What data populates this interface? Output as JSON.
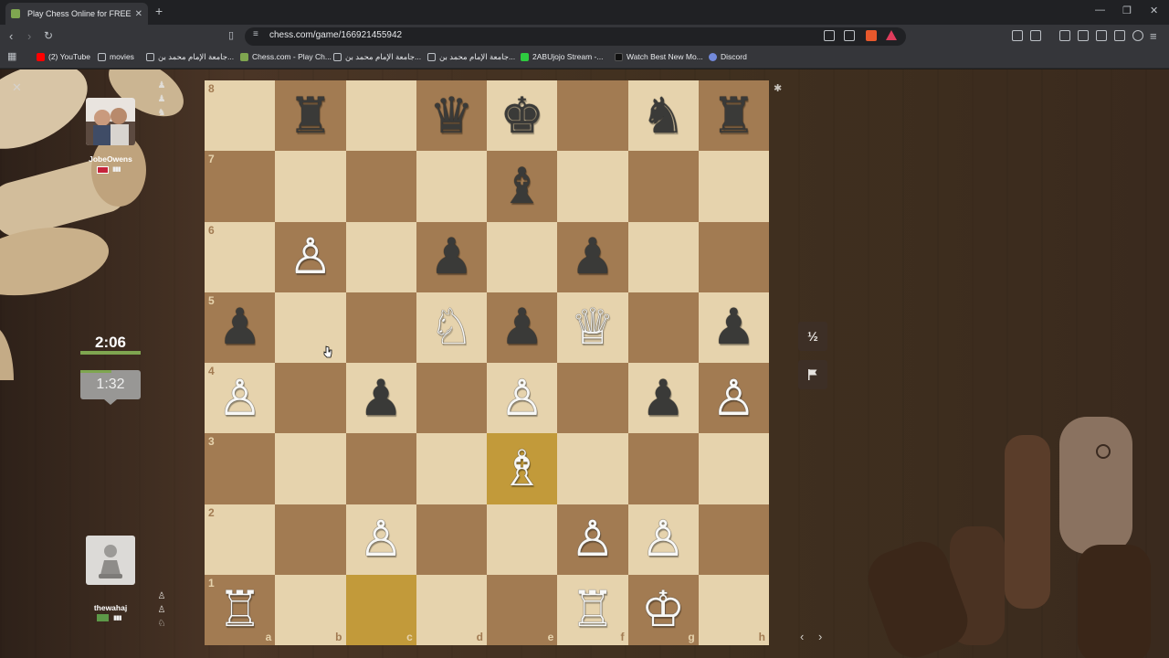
{
  "browser": {
    "tab_title": "Play Chess Online for FREE - ",
    "tab_close": "✕",
    "new_tab": "+",
    "url": "chess.com/game/166921455942",
    "window_controls": [
      "—",
      "❐",
      "✕"
    ],
    "bookmarks": [
      {
        "label": "(2) YouTube",
        "color": "#ff0000"
      },
      {
        "label": "movies",
        "color": "#bdc1c6"
      },
      {
        "label": "جامعة الإمام محمد بن...",
        "color": "#bdc1c6"
      },
      {
        "label": "Chess.com - Play Ch...",
        "color": "#7fa650"
      },
      {
        "label": "جامعة الإمام محمد بن...",
        "color": "#bdc1c6"
      },
      {
        "label": "جامعة الإمام محمد بن...",
        "color": "#bdc1c6"
      },
      {
        "label": "2ABUjojo Stream -...",
        "color": "#2ecc40"
      },
      {
        "label": "Watch Best New Mo...",
        "color": "#111111"
      },
      {
        "label": "Discord",
        "color": "#7289da"
      }
    ]
  },
  "game": {
    "opponent": {
      "name": "JobeOwens",
      "captured_icons": [
        "♟",
        "♟",
        "♞"
      ],
      "signal_icon": "signal-bars-icon",
      "flag_icon": "uk-flag-icon"
    },
    "player": {
      "name": "thewahaj",
      "captured_icons": [
        "♙",
        "♙",
        "♘"
      ],
      "signal_icon": "signal-bars-icon",
      "avatar_icon": "pawn-icon"
    },
    "clock_active": "2:06",
    "clock_idle": "1:32",
    "draw_label": "½",
    "resign_icon": "flag-icon",
    "nav_arrows": "‹ ›",
    "ranks": [
      "8",
      "7",
      "6",
      "5",
      "4",
      "3",
      "2",
      "1"
    ],
    "files": [
      "a",
      "b",
      "c",
      "d",
      "e",
      "f",
      "g",
      "h"
    ],
    "highlighted_squares": [
      "e3",
      "c1"
    ],
    "pieces": [
      {
        "square": "b8",
        "glyph": "♜",
        "color": "b",
        "name": "black-rook"
      },
      {
        "square": "d8",
        "glyph": "♛",
        "color": "b",
        "name": "black-queen"
      },
      {
        "square": "e8",
        "glyph": "♚",
        "color": "b",
        "name": "black-king"
      },
      {
        "square": "g8",
        "glyph": "♞",
        "color": "b",
        "name": "black-knight"
      },
      {
        "square": "h8",
        "glyph": "♜",
        "color": "b",
        "name": "black-rook"
      },
      {
        "square": "e7",
        "glyph": "♝",
        "color": "b",
        "name": "black-bishop"
      },
      {
        "square": "b6",
        "glyph": "♙",
        "color": "w",
        "name": "white-pawn"
      },
      {
        "square": "d6",
        "glyph": "♟",
        "color": "b",
        "name": "black-pawn"
      },
      {
        "square": "f6",
        "glyph": "♟",
        "color": "b",
        "name": "black-pawn"
      },
      {
        "square": "a5",
        "glyph": "♟",
        "color": "b",
        "name": "black-pawn"
      },
      {
        "square": "d5",
        "glyph": "♘",
        "color": "w",
        "name": "white-knight"
      },
      {
        "square": "e5",
        "glyph": "♟",
        "color": "b",
        "name": "black-pawn"
      },
      {
        "square": "f5",
        "glyph": "♕",
        "color": "w",
        "name": "white-queen"
      },
      {
        "square": "h5",
        "glyph": "♟",
        "color": "b",
        "name": "black-pawn"
      },
      {
        "square": "a4",
        "glyph": "♙",
        "color": "w",
        "name": "white-pawn"
      },
      {
        "square": "c4",
        "glyph": "♟",
        "color": "b",
        "name": "black-pawn"
      },
      {
        "square": "e4",
        "glyph": "♙",
        "color": "w",
        "name": "white-pawn"
      },
      {
        "square": "g4",
        "glyph": "♟",
        "color": "b",
        "name": "black-pawn"
      },
      {
        "square": "h4",
        "glyph": "♙",
        "color": "w",
        "name": "white-pawn"
      },
      {
        "square": "e3",
        "glyph": "♗",
        "color": "w",
        "name": "white-bishop"
      },
      {
        "square": "c2",
        "glyph": "♙",
        "color": "w",
        "name": "white-pawn"
      },
      {
        "square": "f2",
        "glyph": "♙",
        "color": "w",
        "name": "white-pawn"
      },
      {
        "square": "g2",
        "glyph": "♙",
        "color": "w",
        "name": "white-pawn"
      },
      {
        "square": "a1",
        "glyph": "♖",
        "color": "w",
        "name": "white-rook"
      },
      {
        "square": "f1",
        "glyph": "♖",
        "color": "w",
        "name": "white-rook"
      },
      {
        "square": "g1",
        "glyph": "♔",
        "color": "w",
        "name": "white-king"
      }
    ]
  }
}
